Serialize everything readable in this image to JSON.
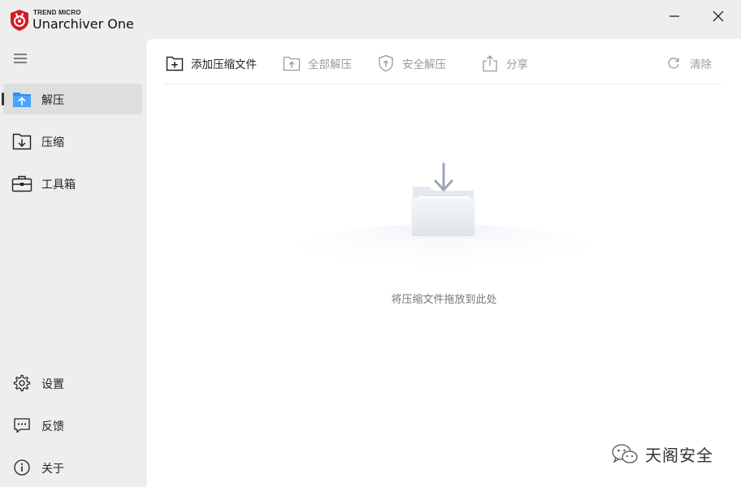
{
  "app": {
    "brand_small": "TREND MICRO",
    "brand_name": "Unarchiver One",
    "accent": "#d71921"
  },
  "window": {
    "minimize_icon": "minimize-icon",
    "close_icon": "close-icon"
  },
  "sidebar": {
    "menu_icon": "hamburger-icon",
    "items": [
      {
        "label": "解压",
        "icon": "extract-folder-icon",
        "active": true
      },
      {
        "label": "压缩",
        "icon": "compress-folder-icon",
        "active": false
      },
      {
        "label": "工具箱",
        "icon": "toolbox-icon",
        "active": false
      }
    ],
    "bottom_items": [
      {
        "label": "设置",
        "icon": "gear-icon"
      },
      {
        "label": "反馈",
        "icon": "feedback-icon"
      },
      {
        "label": "关于",
        "icon": "info-icon"
      }
    ]
  },
  "toolbar": {
    "add": "添加压缩文件",
    "extract_all": "全部解压",
    "safe_extract": "安全解压",
    "share": "分享",
    "clear": "清除"
  },
  "main": {
    "drop_hint": "将压缩文件拖放到此处"
  },
  "watermark": {
    "text": "天阁安全"
  }
}
